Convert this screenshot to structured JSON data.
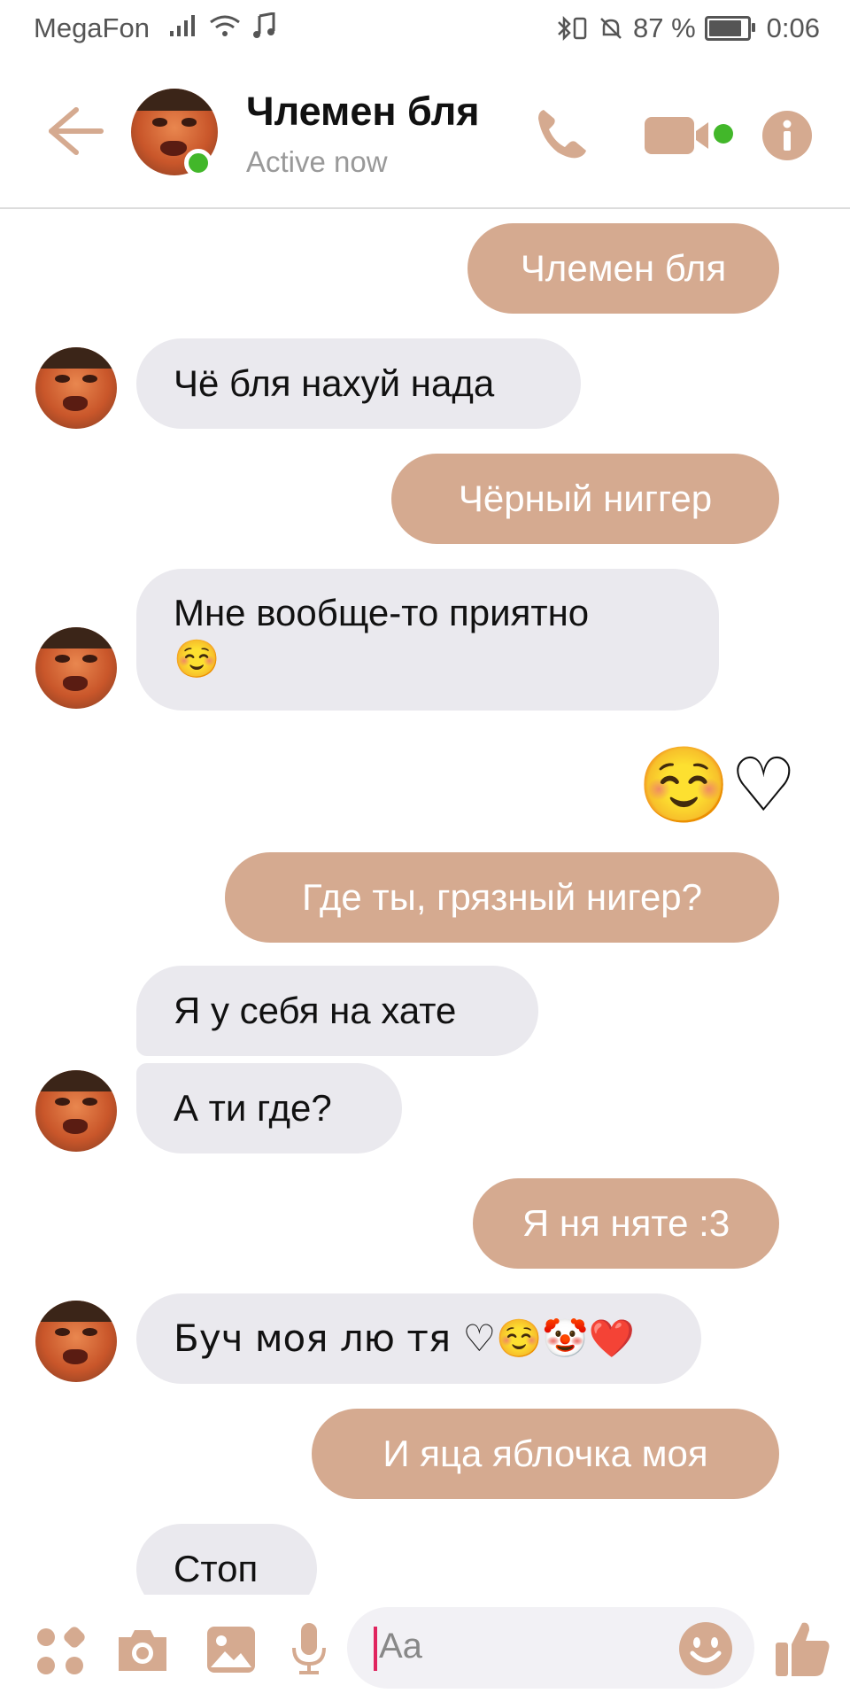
{
  "status_bar": {
    "carrier": "MegaFon",
    "battery_text": "87 %",
    "time": "0:06"
  },
  "header": {
    "contact_name": "Члемен бля",
    "contact_status": "Active now"
  },
  "colors": {
    "accent": "#d5aa90",
    "incoming_bubble": "#eae9ee",
    "online": "#42b72a"
  },
  "messages": [
    {
      "direction": "out",
      "text": "Члемен бля"
    },
    {
      "direction": "in",
      "text": "Чё бля нахуй нада"
    },
    {
      "direction": "out",
      "text": "Чёрный ниггер"
    },
    {
      "direction": "in",
      "text": "Мне вообще-то приятно",
      "text2": "☺️"
    },
    {
      "direction": "out",
      "text": "☺️♡"
    },
    {
      "direction": "out",
      "text": "Где ты, грязный нигер?"
    },
    {
      "direction": "in",
      "text": "Я у себя на хате"
    },
    {
      "direction": "in",
      "text": "А ти где?"
    },
    {
      "direction": "out",
      "text": "Я ня няте :3"
    },
    {
      "direction": "in",
      "text": "Буч моя лю тя ♡☺️🤡❤️"
    },
    {
      "direction": "out",
      "text": "И яца яблочка моя"
    },
    {
      "direction": "in",
      "text": "Стоп"
    }
  ],
  "composer": {
    "placeholder": "Aa"
  }
}
